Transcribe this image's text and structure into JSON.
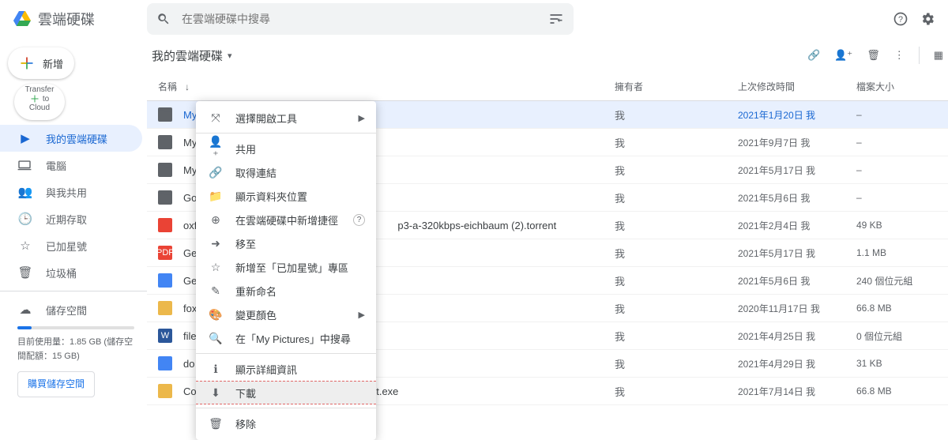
{
  "header": {
    "product": "雲端硬碟",
    "search_placeholder": "在雲端硬碟中搜尋"
  },
  "sidebar": {
    "new_label": "新增",
    "transfer_line1": "Transfer",
    "transfer_line2": "to",
    "transfer_line3": "Cloud",
    "items": [
      {
        "label": "我的雲端硬碟"
      },
      {
        "label": "電腦"
      },
      {
        "label": "與我共用"
      },
      {
        "label": "近期存取"
      },
      {
        "label": "已加星號"
      },
      {
        "label": "垃圾桶"
      }
    ],
    "storage_label": "儲存空間",
    "storage_usage_line1": "目前使用量：1.85 GB (儲存空",
    "storage_usage_line2": "間配額：15 GB)",
    "buy_label": "購買儲存空間"
  },
  "location": {
    "title": "我的雲端硬碟"
  },
  "table": {
    "headers": {
      "name": "名稱",
      "owner": "擁有者",
      "modified": "上次修改時間",
      "size": "檔案大小"
    },
    "rows": [
      {
        "icon": "folder",
        "name": "My",
        "owner": "我",
        "modified": "2021年1月20日 我",
        "size": "–",
        "selected": true
      },
      {
        "icon": "folder",
        "name": "My",
        "owner": "我",
        "modified": "2021年9月7日 我",
        "size": "–"
      },
      {
        "icon": "folder",
        "name": "My",
        "owner": "我",
        "modified": "2021年5月17日 我",
        "size": "–"
      },
      {
        "icon": "folder",
        "name": "Go",
        "owner": "我",
        "modified": "2021年5月6日 我",
        "size": "–"
      },
      {
        "icon": "sh",
        "name": "oxf",
        "name_tail": "p3-a-320kbps-eichbaum (2).torrent",
        "owner": "我",
        "modified": "2021年2月4日 我",
        "size": "49 KB"
      },
      {
        "icon": "pdf",
        "name": "Ge",
        "owner": "我",
        "modified": "2021年5月17日 我",
        "size": "1.1 MB"
      },
      {
        "icon": "doc",
        "name": "Ge",
        "owner": "我",
        "modified": "2021年5月6日 我",
        "size": "240 個位元組"
      },
      {
        "icon": "exe",
        "name": "fox",
        "owner": "我",
        "modified": "2020年11月17日 我",
        "size": "66.8 MB"
      },
      {
        "icon": "word",
        "name": "file",
        "owner": "我",
        "modified": "2021年4月25日 我",
        "size": "0 個位元組"
      },
      {
        "icon": "doc",
        "name": "do",
        "owner": "我",
        "modified": "2021年4月29日 我",
        "size": "31 KB"
      },
      {
        "icon": "exe",
        "name": "Copy of Foxit_GA_NoFinishPage_FoxitInst.exe",
        "owner": "我",
        "modified": "2021年7月14日 我",
        "size": "66.8 MB"
      }
    ]
  },
  "ctx": {
    "items": [
      {
        "label": "選擇開啟工具",
        "sub": true
      },
      {
        "sep": true
      },
      {
        "label": "共用"
      },
      {
        "label": "取得連結"
      },
      {
        "label": "顯示資料夾位置"
      },
      {
        "label": "在雲端硬碟中新增捷徑",
        "help": true
      },
      {
        "label": "移至"
      },
      {
        "label": "新增至「已加星號」專區"
      },
      {
        "label": "重新命名"
      },
      {
        "label": "變更顏色",
        "sub": true
      },
      {
        "label": "在「My Pictures」中搜尋"
      },
      {
        "sep": true
      },
      {
        "label": "顯示詳細資訊"
      },
      {
        "label": "下載",
        "highlight": true
      },
      {
        "sep": true
      },
      {
        "label": "移除"
      }
    ]
  }
}
